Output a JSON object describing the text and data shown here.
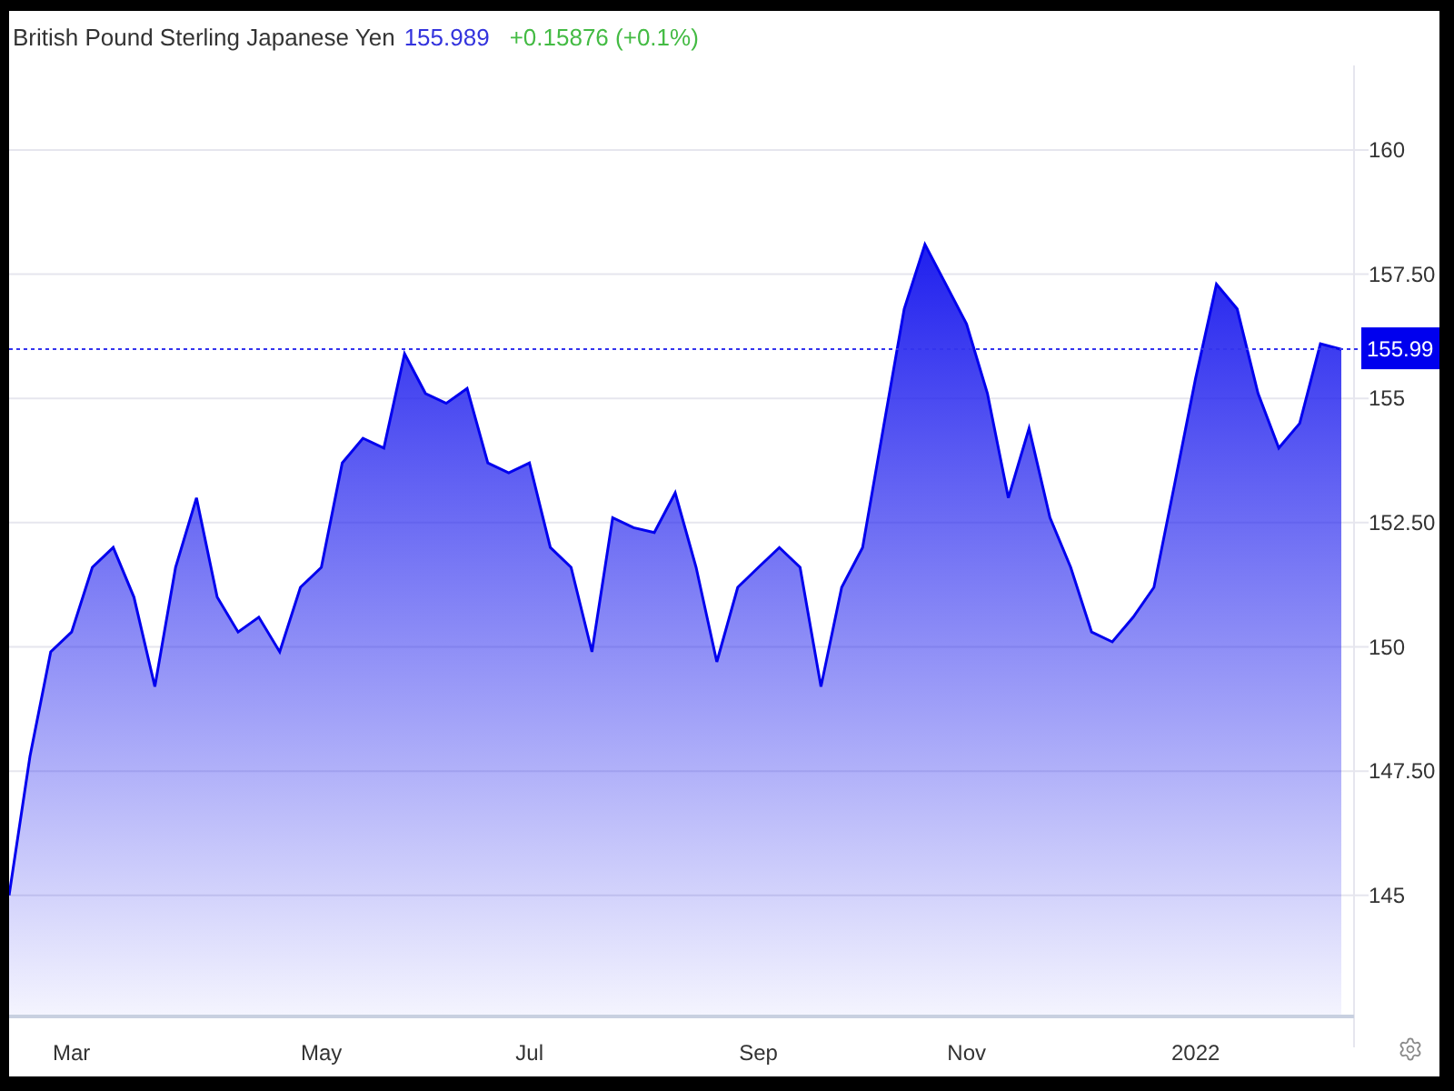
{
  "header": {
    "instrument": "British Pound Sterling Japanese Yen",
    "price": "155.989",
    "change": "+0.15876 (+0.1%)"
  },
  "chart": {
    "last_price_label": "155.99",
    "chart_data": {
      "type": "area",
      "categories": [
        null,
        null,
        null,
        "Mar",
        null,
        null,
        null,
        null,
        null,
        null,
        null,
        null,
        null,
        null,
        null,
        "May",
        null,
        null,
        null,
        null,
        null,
        null,
        null,
        null,
        null,
        "Jul",
        null,
        null,
        null,
        null,
        null,
        null,
        null,
        null,
        null,
        null,
        "Sep",
        null,
        null,
        null,
        null,
        null,
        null,
        null,
        null,
        null,
        "Nov",
        null,
        null,
        null,
        null,
        null,
        null,
        null,
        null,
        null,
        null,
        "2022",
        null,
        null,
        null,
        null,
        null,
        null,
        null
      ],
      "series": [
        {
          "color": "#0000ee",
          "values": [
            145,
            147.8,
            149.9,
            150.3,
            151.6,
            152,
            151,
            149.2,
            151.6,
            153,
            151,
            150.3,
            150.6,
            149.9,
            151.2,
            151.6,
            153.7,
            154.2,
            154,
            155.9,
            155.1,
            154.9,
            155.2,
            153.7,
            153.5,
            153.7,
            152,
            151.6,
            149.9,
            152.6,
            152.4,
            152.3,
            153.1,
            151.6,
            149.7,
            151.2,
            151.6,
            152,
            151.6,
            149.2,
            151.2,
            152,
            154.4,
            156.8,
            158.1,
            157.3,
            156.5,
            155.1,
            153,
            154.4,
            152.6,
            151.6,
            150.3,
            150.1,
            150.6,
            151.2,
            153.3,
            155.4,
            157.3,
            156.8,
            155.1,
            154,
            154.5,
            156.1,
            155.99
          ]
        }
      ],
      "ylim": [
        142.6,
        161.7
      ],
      "grid": true,
      "ref_lines": [
        {
          "axis": "y",
          "value": 155.99
        }
      ],
      "yticks": [
        {
          "value": 145,
          "label": "145"
        },
        {
          "value": 147.5,
          "label": "147.50"
        },
        {
          "value": 150,
          "label": "150"
        },
        {
          "value": 152.5,
          "label": "152.50"
        },
        {
          "value": 155,
          "label": "155"
        },
        {
          "value": 157.5,
          "label": "157.50"
        },
        {
          "value": 160,
          "label": "160"
        }
      ]
    }
  }
}
